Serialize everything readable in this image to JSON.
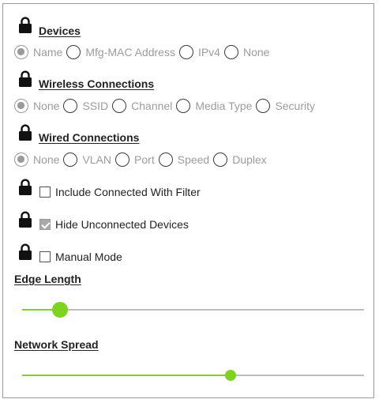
{
  "devices": {
    "title": "Devices",
    "options": [
      "Name",
      "Mfg-MAC Address",
      "IPv4",
      "None"
    ],
    "selected": "Name"
  },
  "wireless": {
    "title": "Wireless Connections",
    "options": [
      "None",
      "SSID",
      "Channel",
      "Media Type",
      "Security"
    ],
    "selected": "None"
  },
  "wired": {
    "title": "Wired Connections",
    "options": [
      "None",
      "VLAN",
      "Port",
      "Speed",
      "Duplex"
    ],
    "selected": "None"
  },
  "checkboxes": {
    "include_connected": {
      "label": "Include Connected With Filter",
      "checked": false
    },
    "hide_unconnected": {
      "label": "Hide Unconnected Devices",
      "checked": true
    },
    "manual_mode": {
      "label": "Manual Mode",
      "checked": false
    }
  },
  "sliders": {
    "edge_length": {
      "label": "Edge Length",
      "value_fraction": 0.11
    },
    "network_spread": {
      "label": "Network Spread",
      "value_fraction": 0.61
    }
  },
  "colors": {
    "accent": "#7ed321",
    "disabled_text": "#9c9c9c",
    "track": "#bdbdbd"
  },
  "icons": [
    "lock-icon"
  ]
}
